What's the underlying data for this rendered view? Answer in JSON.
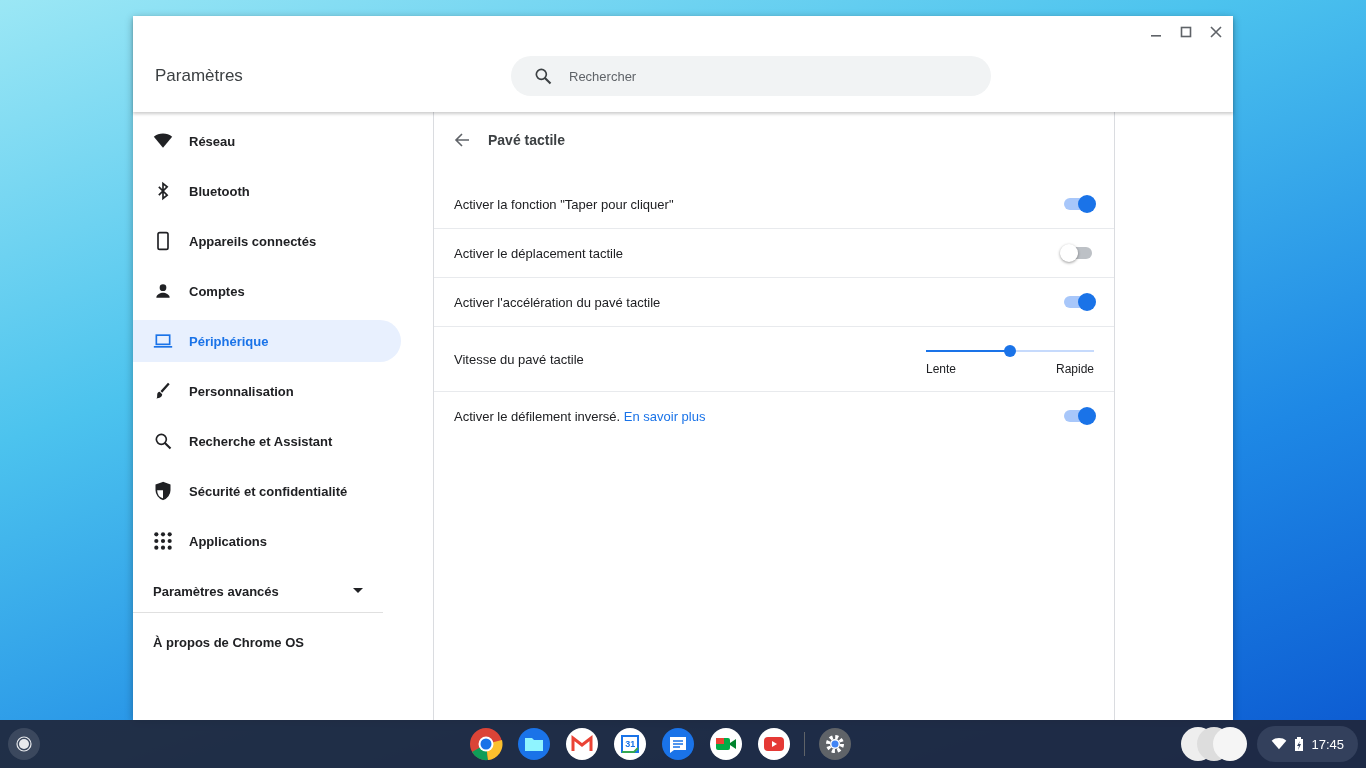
{
  "window": {
    "title": "Paramètres"
  },
  "search": {
    "placeholder": "Rechercher"
  },
  "sidebar": {
    "items": [
      {
        "kind": "wifi",
        "label": "Réseau",
        "selected": false
      },
      {
        "kind": "bluetooth",
        "label": "Bluetooth",
        "selected": false
      },
      {
        "kind": "phone",
        "label": "Appareils connectés",
        "selected": false
      },
      {
        "kind": "person",
        "label": "Comptes",
        "selected": false
      },
      {
        "kind": "laptop",
        "label": "Périphérique",
        "selected": true
      },
      {
        "kind": "brush",
        "label": "Personnalisation",
        "selected": false
      },
      {
        "kind": "search",
        "label": "Recherche et Assistant",
        "selected": false
      },
      {
        "kind": "shield",
        "label": "Sécurité et confidentialité",
        "selected": false
      },
      {
        "kind": "apps",
        "label": "Applications",
        "selected": false
      }
    ],
    "advanced": {
      "label": "Paramètres avancés",
      "expanded": false
    },
    "about": "À propos de Chrome OS"
  },
  "page": {
    "title": "Pavé tactile",
    "settings": [
      {
        "kind": "toggle",
        "label": "Activer la fonction \"Taper pour cliquer\"",
        "on": true
      },
      {
        "kind": "toggle",
        "label": "Activer le déplacement tactile",
        "on": false
      },
      {
        "kind": "toggle",
        "label": "Activer l'accélération du pavé tactile",
        "on": true
      },
      {
        "kind": "slider",
        "label": "Vitesse du pavé tactile",
        "level": 0.5,
        "min_label": "Lente",
        "max_label": "Rapide"
      },
      {
        "kind": "toggle",
        "label": "Activer le défilement inversé.",
        "link": "En savoir plus",
        "on": true
      }
    ]
  },
  "taskbar": {
    "apps": [
      {
        "kind": "chrome"
      },
      {
        "kind": "files"
      },
      {
        "kind": "gmail"
      },
      {
        "kind": "calendar",
        "label": "31"
      },
      {
        "kind": "messages"
      },
      {
        "kind": "meet"
      },
      {
        "kind": "youtube"
      },
      {
        "kind": "settings"
      }
    ],
    "time": "17:45"
  }
}
